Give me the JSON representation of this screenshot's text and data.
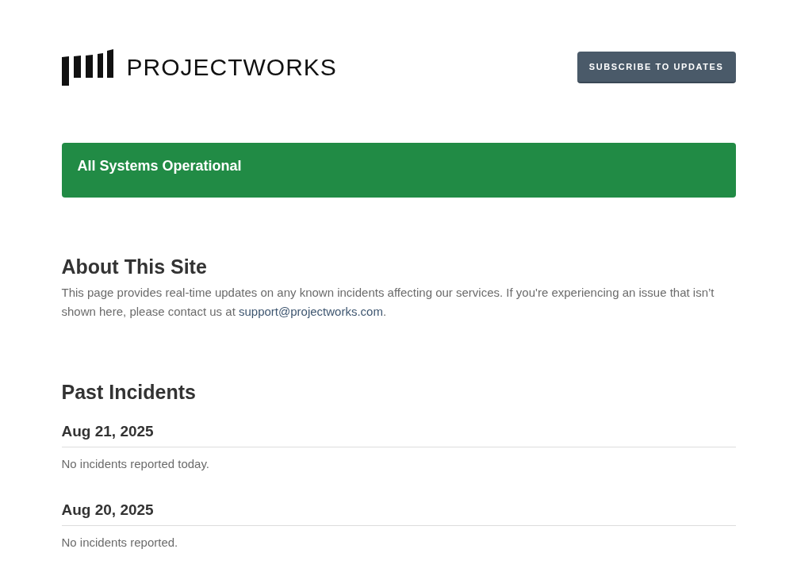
{
  "header": {
    "logo_text": "PROJECTWORKS",
    "subscribe_button": "SUBSCRIBE TO UPDATES"
  },
  "status": {
    "text": "All Systems Operational",
    "color": "#218b45"
  },
  "about": {
    "title": "About This Site",
    "text": "This page provides real-time updates on any known incidents affecting our services. If you're experiencing an issue that isn’t shown here, please contact us at ",
    "link": "support@projectworks.com",
    "after": "."
  },
  "past_incidents": {
    "title": "Past Incidents",
    "days": [
      {
        "date": "Aug 21, 2025",
        "message": "No incidents reported today."
      },
      {
        "date": "Aug 20, 2025",
        "message": "No incidents reported."
      }
    ]
  }
}
